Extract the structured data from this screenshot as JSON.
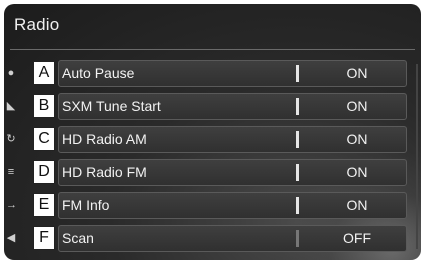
{
  "header": {
    "title": "Radio"
  },
  "rows": [
    {
      "callout": "A",
      "label": "Auto Pause",
      "value": "ON",
      "icon": "music-note-icon",
      "glyph": "●"
    },
    {
      "callout": "B",
      "label": "SXM Tune Start",
      "value": "ON",
      "icon": "satellite-icon",
      "glyph": "◣"
    },
    {
      "callout": "C",
      "label": "HD Radio AM",
      "value": "ON",
      "icon": "rotate-icon",
      "glyph": "↻"
    },
    {
      "callout": "D",
      "label": "HD Radio FM",
      "value": "ON",
      "icon": "list-icon",
      "glyph": "≡"
    },
    {
      "callout": "E",
      "label": "FM Info",
      "value": "ON",
      "icon": "arrow-icon",
      "glyph": "→"
    },
    {
      "callout": "F",
      "label": "Scan",
      "value": "OFF",
      "icon": "speaker-icon",
      "glyph": "◀"
    }
  ]
}
